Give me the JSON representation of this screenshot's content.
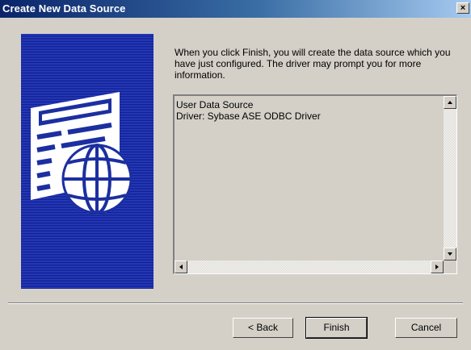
{
  "window": {
    "title": "Create New Data Source",
    "close_label": "×"
  },
  "description": "When you click Finish, you will create the data source which you have just configured.  The driver may prompt you for more information.",
  "summary": {
    "lines": [
      "User Data Source",
      "Driver:  Sybase ASE ODBC Driver"
    ]
  },
  "buttons": {
    "back": "< Back",
    "finish": "Finish",
    "cancel": "Cancel"
  },
  "icons": {
    "wizard_image": "document-globe-icon"
  },
  "colors": {
    "title_bar": "#0a246a",
    "image_background": "#1c2fa0"
  }
}
